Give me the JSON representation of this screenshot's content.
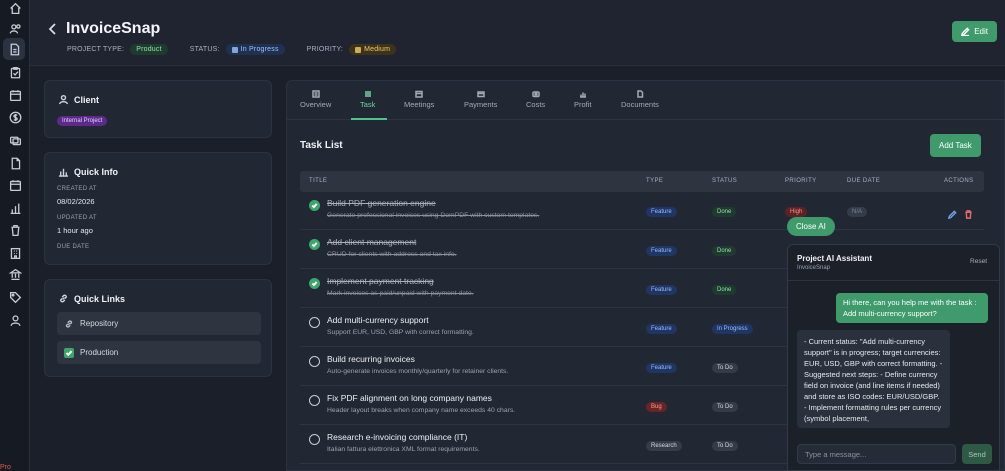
{
  "app": {
    "footer_label": "Pro"
  },
  "rail": {
    "icons": [
      "home-icon",
      "users-icon",
      "document-icon",
      "clipboard-icon",
      "calendar-icon",
      "dollar-icon",
      "layers-icon",
      "file-icon",
      "calendar-alt-icon",
      "chart-icon",
      "trash-icon",
      "building-icon",
      "bank-icon",
      "tag-icon",
      "user-icon"
    ]
  },
  "header": {
    "title": "InvoiceSnap",
    "project_type_label": "PROJECT TYPE:",
    "project_type": "Product",
    "status_label": "STATUS:",
    "status": "In Progress",
    "priority_label": "PRIORITY:",
    "priority": "Medium",
    "edit_label": "Edit"
  },
  "client": {
    "title": "Client",
    "tag": "Internal Project"
  },
  "quick_info": {
    "title": "Quick Info",
    "created_label": "CREATED AT",
    "created": "08/02/2026",
    "updated_label": "UPDATED AT",
    "updated": "1 hour ago",
    "due_label": "DUE DATE"
  },
  "quick_links": {
    "title": "Quick Links",
    "items": [
      {
        "label": "Repository"
      },
      {
        "label": "Production"
      }
    ]
  },
  "tabs": [
    {
      "label": "Overview"
    },
    {
      "label": "Task"
    },
    {
      "label": "Meetings"
    },
    {
      "label": "Payments"
    },
    {
      "label": "Costs"
    },
    {
      "label": "Profit"
    },
    {
      "label": "Documents"
    }
  ],
  "task_list": {
    "title": "Task List",
    "add_label": "Add Task",
    "columns": {
      "title": "TITLE",
      "type": "TYPE",
      "status": "STATUS",
      "priority": "PRIORITY",
      "due": "DUE DATE",
      "actions": "ACTIONS"
    },
    "rows": [
      {
        "title": "Build PDF generation engine",
        "desc": "Generate professional invoices using DomPDF with custom templates.",
        "type": "Feature",
        "status": "Done",
        "priority": "High",
        "due": "N/A",
        "done": true
      },
      {
        "title": "Add client management",
        "desc": "CRUD for clients with address and tax info.",
        "type": "Feature",
        "status": "Done",
        "done": true
      },
      {
        "title": "Implement payment tracking",
        "desc": "Mark invoices as paid/unpaid with payment date.",
        "type": "Feature",
        "status": "Done",
        "done": true
      },
      {
        "title": "Add multi-currency support",
        "desc": "Support EUR, USD, GBP with correct formatting.",
        "type": "Feature",
        "status": "In Progress",
        "done": false
      },
      {
        "title": "Build recurring invoices",
        "desc": "Auto-generate invoices monthly/quarterly for retainer clients.",
        "type": "Feature",
        "status": "To Do",
        "done": false
      },
      {
        "title": "Fix PDF alignment on long company names",
        "desc": "Header layout breaks when company name exceeds 40 chars.",
        "type": "Bug",
        "status": "To Do",
        "done": false
      },
      {
        "title": "Research e-invoicing compliance (IT)",
        "desc": "Italian fattura elettronica XML format requirements.",
        "type": "Research",
        "status": "To Do",
        "done": false
      }
    ]
  },
  "ai": {
    "close_label": "Close AI",
    "title": "Project AI Assistant",
    "subtitle": "InvoiceSnap",
    "reset_label": "Reset",
    "user_message": "Hi there, can you help me with the task : Add multi-currency support?",
    "assistant_message": "- Current status: \"Add multi-currency support\" is in progress; target currencies: EUR, USD, GBP with correct formatting. - Suggested next steps: - Define currency field on invoice (and line items if needed) and store as ISO codes: EUR/USD/GBP. - Implement formatting rules per currency (symbol placement,",
    "input_placeholder": "Type a message...",
    "send_label": "Send"
  },
  "colors": {
    "accent": "#3f9a6c",
    "background": "#1a1f29",
    "panel": "#222833"
  }
}
